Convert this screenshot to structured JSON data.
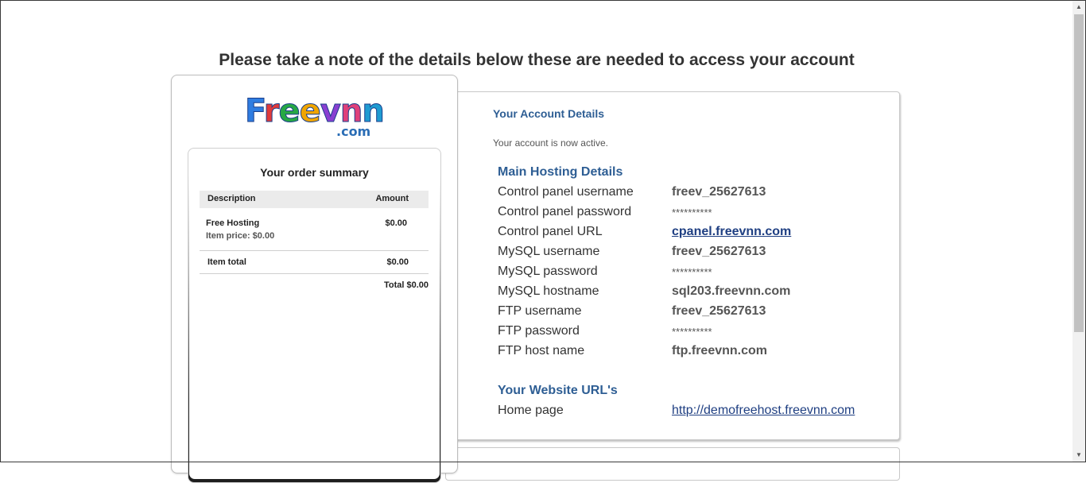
{
  "headline": "Please take a note of the details below these are needed to access your account",
  "logo": {
    "letters": [
      {
        "ch": "F",
        "color": "#2f7de1"
      },
      {
        "ch": "r",
        "color": "#e03a3a"
      },
      {
        "ch": "e",
        "color": "#27a844"
      },
      {
        "ch": "e",
        "color": "#f0a500"
      },
      {
        "ch": "v",
        "color": "#8a3fd1"
      },
      {
        "ch": "n",
        "color": "#e0407a"
      },
      {
        "ch": "n",
        "color": "#1f9bd1"
      }
    ],
    "suffix": ".com"
  },
  "summary": {
    "title": "Your order summary",
    "col_description": "Description",
    "col_amount": "Amount",
    "item_name": "Free Hosting",
    "item_price": "Item price: $0.00",
    "item_amount": "$0.00",
    "item_total_label": "Item total",
    "item_total_amount": "$0.00",
    "grand_total": "Total $0.00"
  },
  "account": {
    "title": "Your Account Details",
    "status": "Your account is now active.",
    "hosting_title": "Main Hosting Details",
    "hosting_rows": [
      {
        "label": "Control panel username",
        "value": "freev_25627613"
      },
      {
        "label": "Control panel password",
        "value": "**********"
      },
      {
        "label": "Control panel URL",
        "value": "cpanel.freevnn.com"
      },
      {
        "label": "MySQL username",
        "value": "freev_25627613"
      },
      {
        "label": "MySQL password",
        "value": "**********"
      },
      {
        "label": "MySQL hostname",
        "value": "sql203.freevnn.com"
      },
      {
        "label": "FTP username",
        "value": "freev_25627613"
      },
      {
        "label": "FTP password",
        "value": "**********"
      },
      {
        "label": "FTP host name",
        "value": "ftp.freevnn.com"
      }
    ],
    "website_title": "Your Website URL's",
    "website_rows": [
      {
        "label": "Home page",
        "value": "http://demofreehost.freevnn.com"
      }
    ]
  },
  "scrollbar": {
    "up": "▲",
    "down": "▼"
  }
}
